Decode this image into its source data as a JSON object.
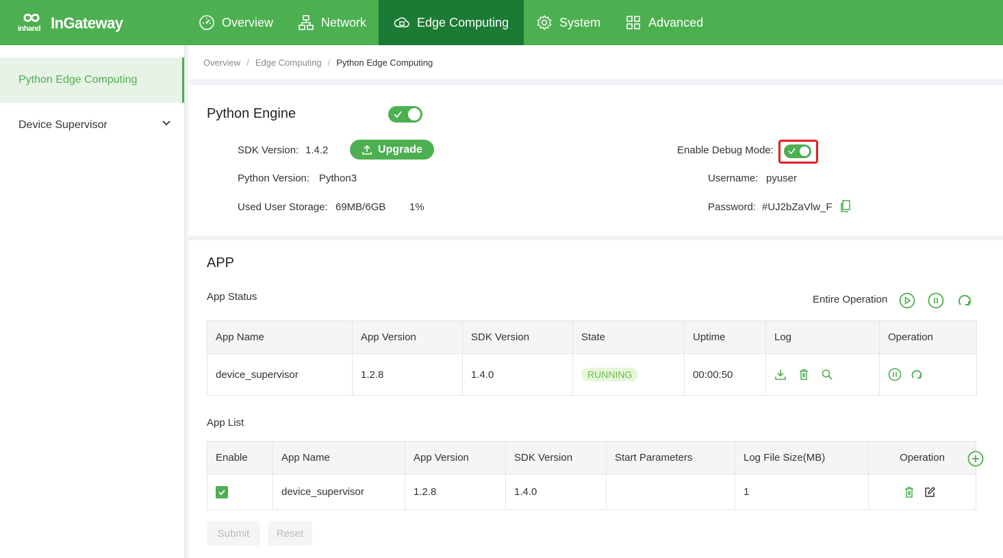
{
  "brand": {
    "logo_small": "inhand",
    "logo_text": "InGateway"
  },
  "nav": [
    {
      "label": "Overview",
      "icon": "dashboard-icon"
    },
    {
      "label": "Network",
      "icon": "network-icon"
    },
    {
      "label": "Edge Computing",
      "icon": "cloud-compute-icon",
      "active": true
    },
    {
      "label": "System",
      "icon": "gear-icon"
    },
    {
      "label": "Advanced",
      "icon": "grid-icon"
    }
  ],
  "sidebar": {
    "items": [
      {
        "label": "Python Edge Computing",
        "active": true
      },
      {
        "label": "Device Supervisor",
        "expandable": true
      }
    ]
  },
  "breadcrumb": [
    "Overview",
    "Edge Computing",
    "Python Edge Computing"
  ],
  "engine": {
    "title": "Python Engine",
    "enabled": true,
    "sdk_label": "SDK Version:",
    "sdk_value": "1.4.2",
    "upgrade_label": "Upgrade",
    "python_label": "Python Version:",
    "python_value": "Python3",
    "storage_label": "Used User Storage:",
    "storage_value": "69MB/6GB",
    "storage_percent": "1%",
    "debug_label": "Enable Debug Mode:",
    "debug_enabled": true,
    "username_label": "Username:",
    "username_value": "pyuser",
    "password_label": "Password:",
    "password_value": "#UJ2bZaVlw_F"
  },
  "app": {
    "title": "APP",
    "status_label": "App Status",
    "entire_operation_label": "Entire Operation",
    "status_table": {
      "headers": [
        "App Name",
        "App Version",
        "SDK Version",
        "State",
        "Uptime",
        "Log",
        "Operation"
      ],
      "rows": [
        {
          "name": "device_supervisor",
          "app_version": "1.2.8",
          "sdk_version": "1.4.0",
          "state": "RUNNING",
          "uptime": "00:00:50"
        }
      ]
    },
    "list_label": "App List",
    "list_table": {
      "headers": [
        "Enable",
        "App Name",
        "App Version",
        "SDK Version",
        "Start Parameters",
        "Log File Size(MB)",
        "Operation"
      ],
      "rows": [
        {
          "enabled": true,
          "name": "device_supervisor",
          "app_version": "1.2.8",
          "sdk_version": "1.4.0",
          "start_params": "",
          "log_size": "1"
        }
      ]
    },
    "submit_label": "Submit",
    "reset_label": "Reset"
  },
  "colors": {
    "primary": "#4caf50",
    "nav_active": "#1b7a33",
    "highlight": "#e02020"
  }
}
